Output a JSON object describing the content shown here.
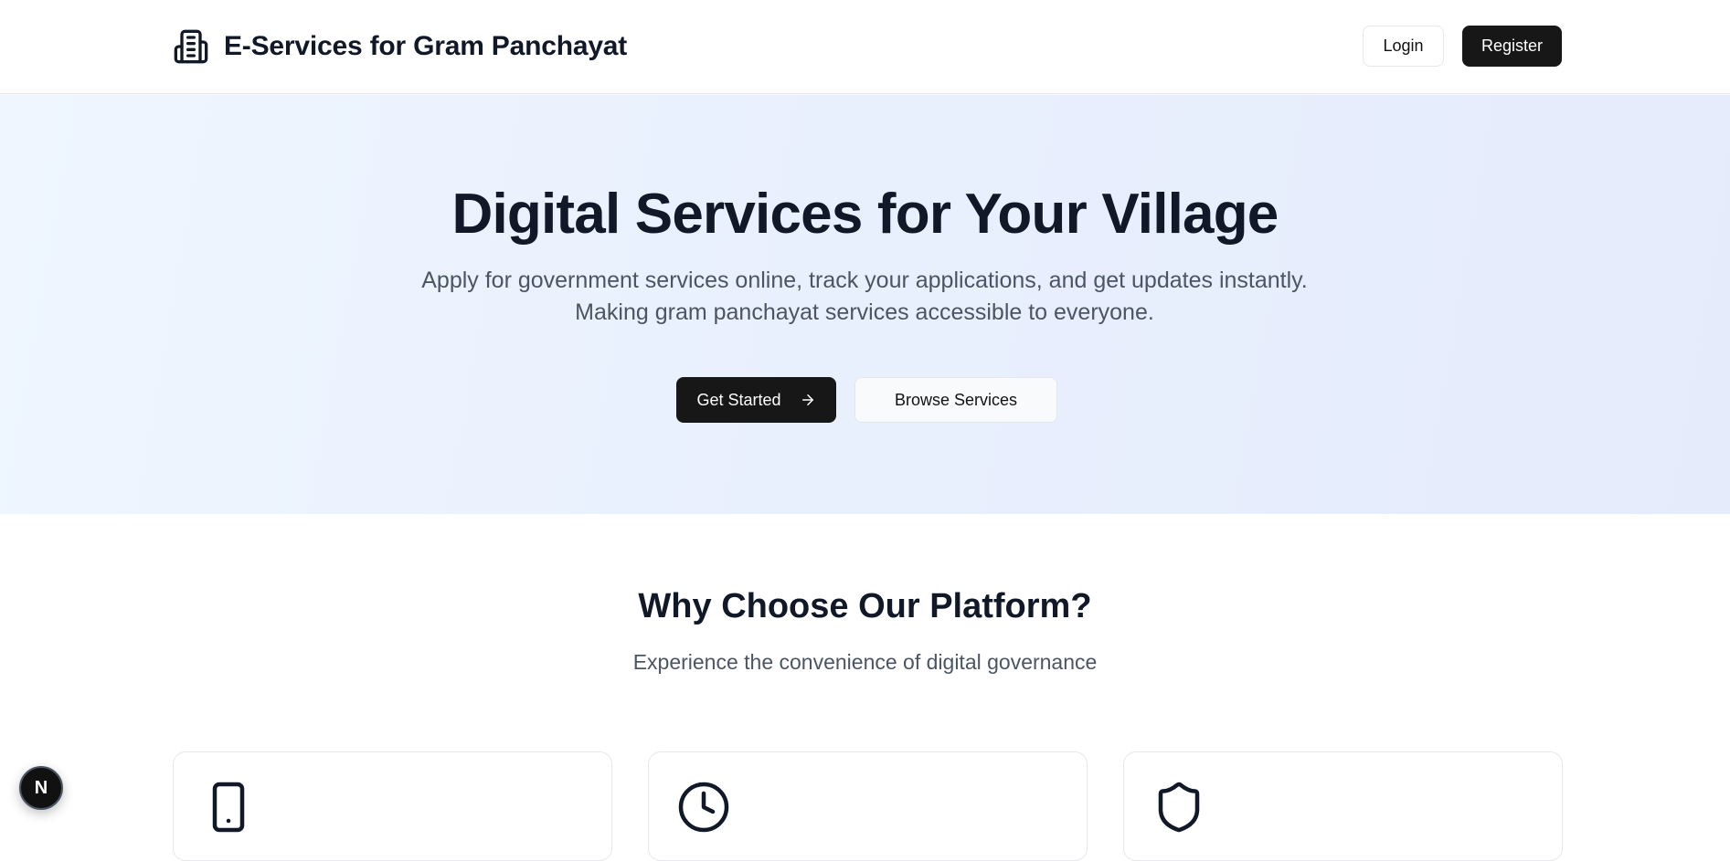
{
  "header": {
    "brand_icon": "building-icon",
    "brand_title": "E-Services for Gram Panchayat",
    "login_label": "Login",
    "register_label": "Register"
  },
  "hero": {
    "title": "Digital Services for Your Village",
    "subtitle": "Apply for government services online, track your applications, and get updates instantly. Making gram panchayat services accessible to everyone.",
    "get_started_label": "Get Started",
    "get_started_icon": "arrow-right-icon",
    "browse_label": "Browse Services"
  },
  "features": {
    "title": "Why Choose Our Platform?",
    "subtitle": "Experience the convenience of digital governance",
    "cards": [
      {
        "icon": "smartphone-icon"
      },
      {
        "icon": "clock-icon"
      },
      {
        "icon": "shield-icon"
      }
    ]
  },
  "floating_badge": {
    "label": "N",
    "icon": "nextjs-badge-icon"
  },
  "colors": {
    "primary": "#171717",
    "heading": "#111827",
    "body_text": "#4b5563",
    "hero_bg": "#eaf0fd",
    "border": "#e5e7eb"
  }
}
